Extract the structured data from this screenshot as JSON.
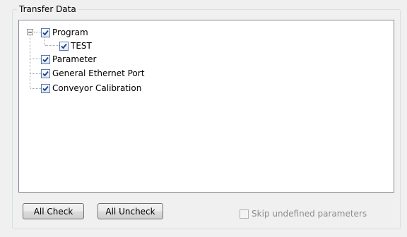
{
  "group": {
    "title": "Transfer Data"
  },
  "tree": {
    "items": [
      {
        "label": "Program",
        "checked": true
      },
      {
        "label": "TEST",
        "checked": true
      },
      {
        "label": "Parameter",
        "checked": true
      },
      {
        "label": "General Ethernet Port",
        "checked": true
      },
      {
        "label": "Conveyor Calibration",
        "checked": true
      }
    ]
  },
  "buttons": {
    "all_check": "All Check",
    "all_uncheck": "All Uncheck"
  },
  "options": {
    "skip_label": "Skip undefined parameters",
    "skip_checked": false,
    "skip_enabled": false
  },
  "colors": {
    "checkmark": "#1a3d8f",
    "window": "#f0f0f0"
  }
}
